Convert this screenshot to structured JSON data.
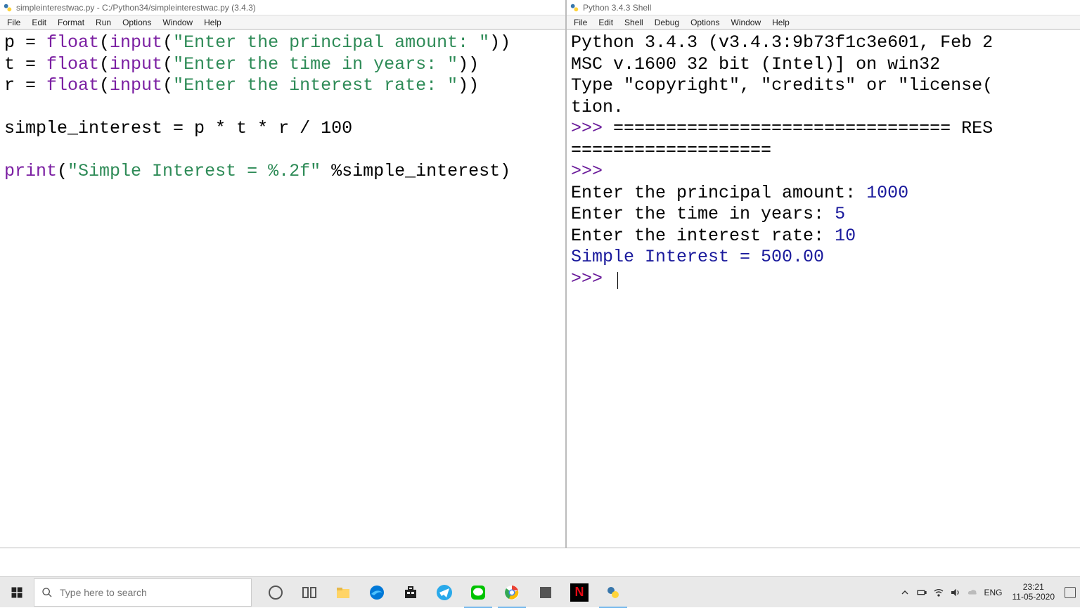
{
  "editor": {
    "title": "simpleinterestwac.py - C:/Python34/simpleinterestwac.py (3.4.3)",
    "menu": [
      "File",
      "Edit",
      "Format",
      "Run",
      "Options",
      "Window",
      "Help"
    ],
    "code": {
      "l1_var": "p = ",
      "l1_float": "float",
      "l1_p1": "(",
      "l1_input": "input",
      "l1_p2": "(",
      "l1_str": "\"Enter the principal amount: \"",
      "l1_p3": "))",
      "l2_var": "t = ",
      "l2_float": "float",
      "l2_p1": "(",
      "l2_input": "input",
      "l2_p2": "(",
      "l2_str": "\"Enter the time in years: \"",
      "l2_p3": "))",
      "l3_var": "r = ",
      "l3_float": "float",
      "l3_p1": "(",
      "l3_input": "input",
      "l3_p2": "(",
      "l3_str": "\"Enter the interest rate: \"",
      "l3_p3": "))",
      "l5": "simple_interest = p * t * r / 100",
      "l7_print": "print",
      "l7_p1": "(",
      "l7_str": "\"Simple Interest = %.2f\"",
      "l7_rest": " %simple_interest)"
    }
  },
  "shell": {
    "title": "Python 3.4.3 Shell",
    "menu": [
      "File",
      "Edit",
      "Shell",
      "Debug",
      "Options",
      "Window",
      "Help"
    ],
    "lines": {
      "banner1": "Python 3.4.3 (v3.4.3:9b73f1c3e601, Feb 2",
      "banner2": "MSC v.1600 32 bit (Intel)] on win32",
      "banner3a": "Type ",
      "banner3b": "\"copyright\"",
      "banner3c": ", ",
      "banner3d": "\"credits\"",
      "banner3e": " or ",
      "banner3f": "\"license(",
      "banner4": "tion.",
      "prompt1": ">>> ",
      "restart": "================================ RES",
      "restart2": "===================",
      "prompt2": ">>> ",
      "io1a": "Enter the principal amount: ",
      "io1b": "1000",
      "io2a": "Enter the time in years: ",
      "io2b": "5",
      "io3a": "Enter the interest rate: ",
      "io3b": "10",
      "io4": "Simple Interest = 500.00",
      "prompt3": ">>> "
    }
  },
  "taskbar": {
    "search_placeholder": "Type here to search",
    "lang": "ENG",
    "time": "23:21",
    "date": "11-05-2020"
  }
}
